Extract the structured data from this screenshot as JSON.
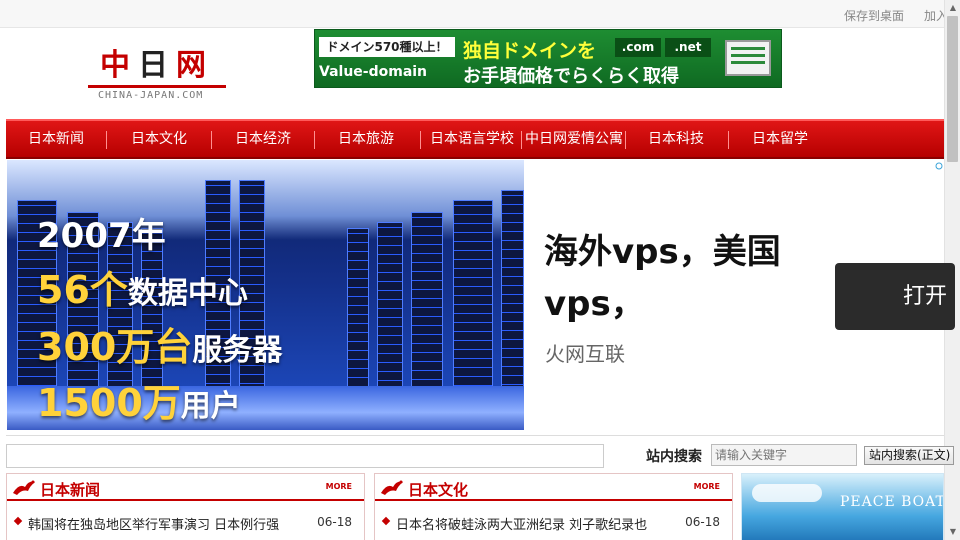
{
  "topbar": {
    "save_desktop": "保存到桌面",
    "add_favorite": "加入"
  },
  "logo": {
    "mark_left": "中",
    "mark_mid": "日",
    "mark_right": "网",
    "domain": "CHINA-JAPAN.COM"
  },
  "top_ad": {
    "tag": "ドメイン570種以上！",
    "brand": "Value-domain",
    "headline": "独自ドメインを",
    "tld_1": ".com",
    "tld_2": ".net",
    "sub": "お手頃価格でらくらく取得",
    "accent": "#1e8d32"
  },
  "nav": {
    "items": [
      {
        "label": "日本新闻"
      },
      {
        "label": "日本文化"
      },
      {
        "label": "日本经济"
      },
      {
        "label": "日本旅游"
      },
      {
        "label": "日本语言学校"
      },
      {
        "label": "中日网爱情公寓"
      },
      {
        "label": "日本科技"
      },
      {
        "label": "日本留学"
      }
    ],
    "color": "#c40000"
  },
  "banner": {
    "line1": "2007年",
    "line2_num": "56个",
    "line2_text": "数据中心",
    "line3_num": "300万台",
    "line3_text": "服务器",
    "line4_num": "1500万",
    "line4_text": "用户",
    "title": "海外vps，美国vps，",
    "brand": "火网互联",
    "button": "打开"
  },
  "search": {
    "label": "站内搜索",
    "placeholder": "请输入关键字",
    "button": "站内搜索(正文)"
  },
  "boxes": [
    {
      "title": "日本新闻",
      "more": "MORE",
      "rows": [
        {
          "text": "韩国将在独岛地区举行军事演习 日本例行强",
          "date": "06-18"
        }
      ]
    },
    {
      "title": "日本文化",
      "more": "MORE",
      "rows": [
        {
          "text": "日本名将破蛙泳两大亚洲纪录 刘子歌纪录也",
          "date": "06-18"
        }
      ]
    }
  ],
  "peace_ad": {
    "text": "PEACE BOAT"
  }
}
